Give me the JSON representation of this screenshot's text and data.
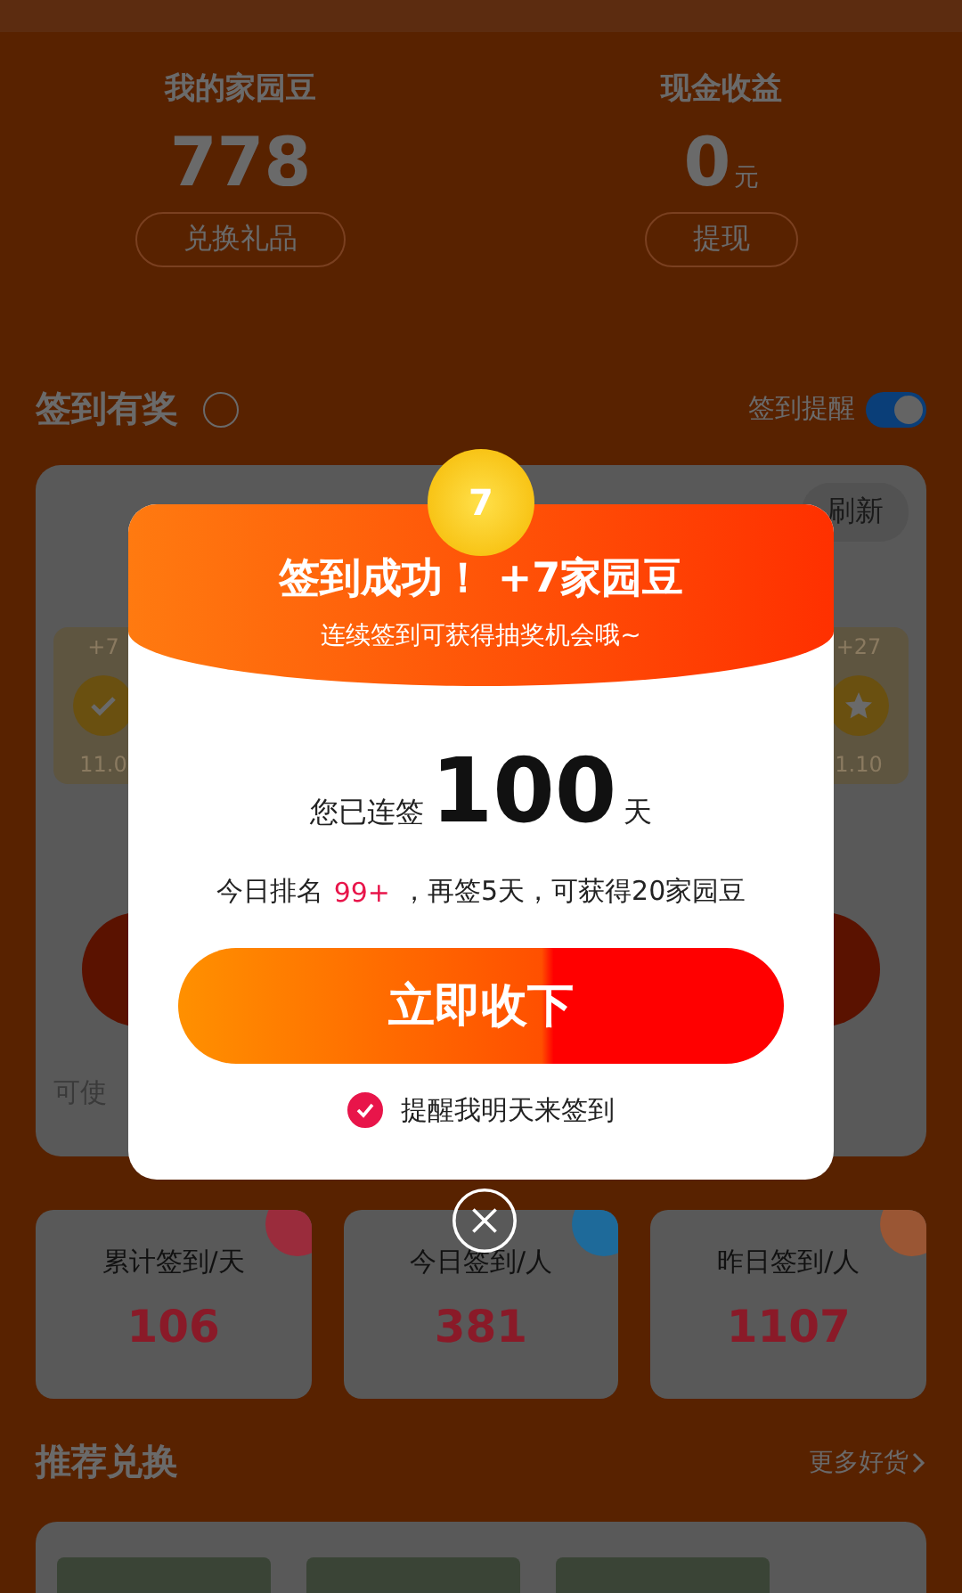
{
  "assets": [
    {
      "label": "我的家园豆",
      "value": "778",
      "button": "兑换礼品"
    },
    {
      "label": "现金收益",
      "value": "0",
      "unit": "元",
      "button": "提现"
    }
  ],
  "sign_section": {
    "title": "签到有奖",
    "reminder_label": "签到提醒",
    "reminder_on": true,
    "refresh": "刷新",
    "days": [
      {
        "reward": "+7",
        "date": "11.0",
        "kind": "check"
      },
      {
        "reward": "+27",
        "date": "1.10",
        "kind": "star"
      }
    ],
    "footer": "可使"
  },
  "stats": [
    {
      "label": "累计签到/天",
      "value": "106",
      "color": "#9a2c3c"
    },
    {
      "label": "今日签到/人",
      "value": "381",
      "color": "#1e6a9a"
    },
    {
      "label": "昨日签到/人",
      "value": "1107",
      "color": "#9a5634"
    }
  ],
  "recommend": {
    "title": "推荐兑换",
    "more": "更多好货"
  },
  "dialog": {
    "coin": "7",
    "title": "签到成功！ +7家园豆",
    "subtitle": "连续签到可获得抽奖机会哦~",
    "streak_prefix": "您已连签",
    "streak_days": "100",
    "streak_unit": "天",
    "rank_label": "今日排名",
    "rank_value": "99+",
    "rank_suffix": "，再签5天，可获得20家园豆",
    "button": "立即收下",
    "remind": {
      "label": "提醒我明天来签到",
      "checked": true
    }
  }
}
